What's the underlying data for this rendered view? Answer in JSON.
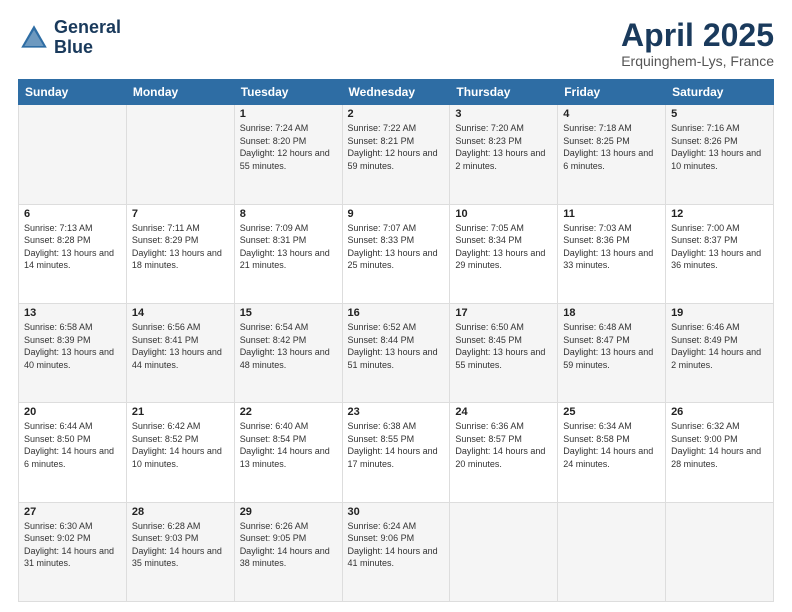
{
  "header": {
    "logo_line1": "General",
    "logo_line2": "Blue",
    "month_year": "April 2025",
    "location": "Erquinghem-Lys, France"
  },
  "days_of_week": [
    "Sunday",
    "Monday",
    "Tuesday",
    "Wednesday",
    "Thursday",
    "Friday",
    "Saturday"
  ],
  "weeks": [
    [
      {
        "day": "",
        "info": ""
      },
      {
        "day": "",
        "info": ""
      },
      {
        "day": "1",
        "info": "Sunrise: 7:24 AM\nSunset: 8:20 PM\nDaylight: 12 hours and 55 minutes."
      },
      {
        "day": "2",
        "info": "Sunrise: 7:22 AM\nSunset: 8:21 PM\nDaylight: 12 hours and 59 minutes."
      },
      {
        "day": "3",
        "info": "Sunrise: 7:20 AM\nSunset: 8:23 PM\nDaylight: 13 hours and 2 minutes."
      },
      {
        "day": "4",
        "info": "Sunrise: 7:18 AM\nSunset: 8:25 PM\nDaylight: 13 hours and 6 minutes."
      },
      {
        "day": "5",
        "info": "Sunrise: 7:16 AM\nSunset: 8:26 PM\nDaylight: 13 hours and 10 minutes."
      }
    ],
    [
      {
        "day": "6",
        "info": "Sunrise: 7:13 AM\nSunset: 8:28 PM\nDaylight: 13 hours and 14 minutes."
      },
      {
        "day": "7",
        "info": "Sunrise: 7:11 AM\nSunset: 8:29 PM\nDaylight: 13 hours and 18 minutes."
      },
      {
        "day": "8",
        "info": "Sunrise: 7:09 AM\nSunset: 8:31 PM\nDaylight: 13 hours and 21 minutes."
      },
      {
        "day": "9",
        "info": "Sunrise: 7:07 AM\nSunset: 8:33 PM\nDaylight: 13 hours and 25 minutes."
      },
      {
        "day": "10",
        "info": "Sunrise: 7:05 AM\nSunset: 8:34 PM\nDaylight: 13 hours and 29 minutes."
      },
      {
        "day": "11",
        "info": "Sunrise: 7:03 AM\nSunset: 8:36 PM\nDaylight: 13 hours and 33 minutes."
      },
      {
        "day": "12",
        "info": "Sunrise: 7:00 AM\nSunset: 8:37 PM\nDaylight: 13 hours and 36 minutes."
      }
    ],
    [
      {
        "day": "13",
        "info": "Sunrise: 6:58 AM\nSunset: 8:39 PM\nDaylight: 13 hours and 40 minutes."
      },
      {
        "day": "14",
        "info": "Sunrise: 6:56 AM\nSunset: 8:41 PM\nDaylight: 13 hours and 44 minutes."
      },
      {
        "day": "15",
        "info": "Sunrise: 6:54 AM\nSunset: 8:42 PM\nDaylight: 13 hours and 48 minutes."
      },
      {
        "day": "16",
        "info": "Sunrise: 6:52 AM\nSunset: 8:44 PM\nDaylight: 13 hours and 51 minutes."
      },
      {
        "day": "17",
        "info": "Sunrise: 6:50 AM\nSunset: 8:45 PM\nDaylight: 13 hours and 55 minutes."
      },
      {
        "day": "18",
        "info": "Sunrise: 6:48 AM\nSunset: 8:47 PM\nDaylight: 13 hours and 59 minutes."
      },
      {
        "day": "19",
        "info": "Sunrise: 6:46 AM\nSunset: 8:49 PM\nDaylight: 14 hours and 2 minutes."
      }
    ],
    [
      {
        "day": "20",
        "info": "Sunrise: 6:44 AM\nSunset: 8:50 PM\nDaylight: 14 hours and 6 minutes."
      },
      {
        "day": "21",
        "info": "Sunrise: 6:42 AM\nSunset: 8:52 PM\nDaylight: 14 hours and 10 minutes."
      },
      {
        "day": "22",
        "info": "Sunrise: 6:40 AM\nSunset: 8:54 PM\nDaylight: 14 hours and 13 minutes."
      },
      {
        "day": "23",
        "info": "Sunrise: 6:38 AM\nSunset: 8:55 PM\nDaylight: 14 hours and 17 minutes."
      },
      {
        "day": "24",
        "info": "Sunrise: 6:36 AM\nSunset: 8:57 PM\nDaylight: 14 hours and 20 minutes."
      },
      {
        "day": "25",
        "info": "Sunrise: 6:34 AM\nSunset: 8:58 PM\nDaylight: 14 hours and 24 minutes."
      },
      {
        "day": "26",
        "info": "Sunrise: 6:32 AM\nSunset: 9:00 PM\nDaylight: 14 hours and 28 minutes."
      }
    ],
    [
      {
        "day": "27",
        "info": "Sunrise: 6:30 AM\nSunset: 9:02 PM\nDaylight: 14 hours and 31 minutes."
      },
      {
        "day": "28",
        "info": "Sunrise: 6:28 AM\nSunset: 9:03 PM\nDaylight: 14 hours and 35 minutes."
      },
      {
        "day": "29",
        "info": "Sunrise: 6:26 AM\nSunset: 9:05 PM\nDaylight: 14 hours and 38 minutes."
      },
      {
        "day": "30",
        "info": "Sunrise: 6:24 AM\nSunset: 9:06 PM\nDaylight: 14 hours and 41 minutes."
      },
      {
        "day": "",
        "info": ""
      },
      {
        "day": "",
        "info": ""
      },
      {
        "day": "",
        "info": ""
      }
    ]
  ]
}
